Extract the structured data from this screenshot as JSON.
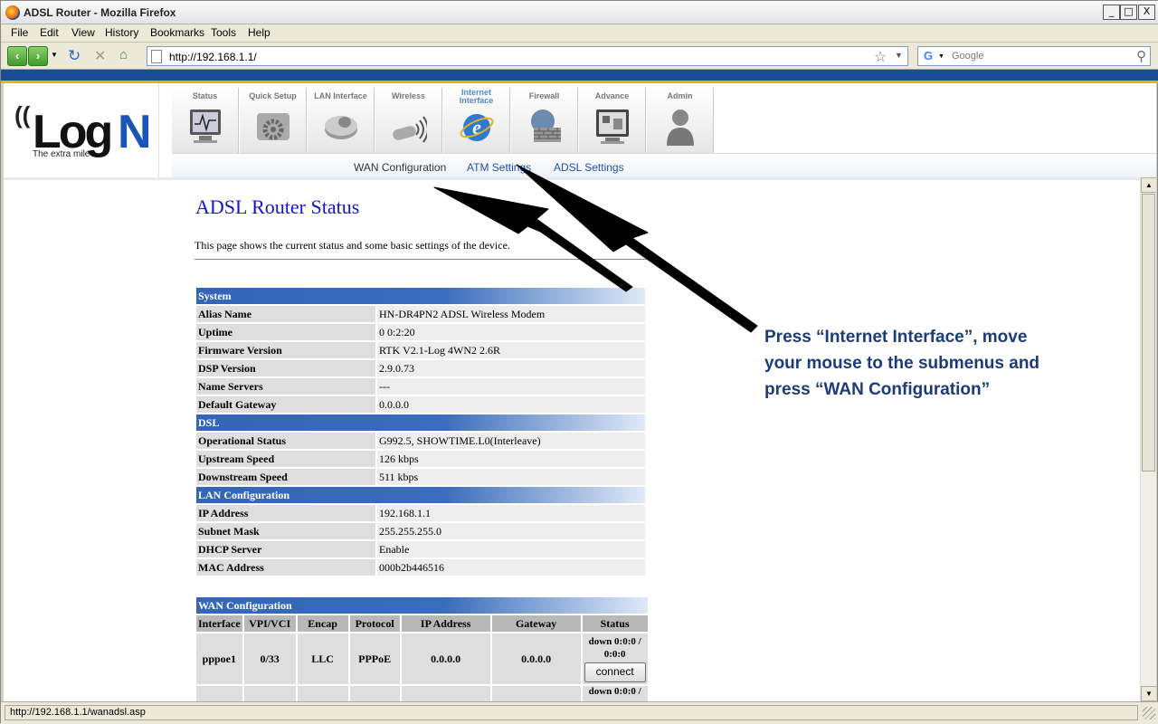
{
  "window": {
    "title": "ADSL Router - Mozilla Firefox",
    "min": "_",
    "max": "□",
    "close": "X"
  },
  "menu": [
    "File",
    "Edit",
    "View",
    "History",
    "Bookmarks",
    "Tools",
    "Help"
  ],
  "toolbar": {
    "url": "http://192.168.1.1/",
    "search_placeholder": "Google"
  },
  "logo": {
    "main": "Log",
    "accent": "N",
    "tagline": "The extra mile"
  },
  "tabs": [
    {
      "label": "Status",
      "icon": "monitor-icon"
    },
    {
      "label": "Quick Setup",
      "icon": "gear-icon"
    },
    {
      "label": "LAN Interface",
      "icon": "hard-drive-icon"
    },
    {
      "label": "Wireless",
      "icon": "wireless-adapter-icon"
    },
    {
      "label": "Internet\nInterface",
      "icon": "internet-explorer-icon"
    },
    {
      "label": "Firewall",
      "icon": "firewall-icon"
    },
    {
      "label": "Advance",
      "icon": "advance-monitor-icon"
    },
    {
      "label": "Admin",
      "icon": "user-icon"
    }
  ],
  "subnav": [
    "WAN Configuration",
    "ATM Settings",
    "ADSL Settings"
  ],
  "page": {
    "title": "ADSL Router Status",
    "description": "This page shows the current status and some basic settings of the device."
  },
  "system": {
    "header": "System",
    "rows": [
      {
        "label": "Alias Name",
        "value": "HN-DR4PN2 ADSL Wireless Modem"
      },
      {
        "label": "Uptime",
        "value": "0 0:2:20"
      },
      {
        "label": "Firmware Version",
        "value": "RTK V2.1-Log 4WN2 2.6R"
      },
      {
        "label": "DSP Version",
        "value": "2.9.0.73"
      },
      {
        "label": "Name Servers",
        "value": "---"
      },
      {
        "label": "Default Gateway",
        "value": "0.0.0.0"
      }
    ]
  },
  "dsl": {
    "header": "DSL",
    "rows": [
      {
        "label": "Operational Status",
        "value": "G992.5, SHOWTIME.L0(Interleave)"
      },
      {
        "label": "Upstream Speed",
        "value": "126 kbps"
      },
      {
        "label": "Downstream Speed",
        "value": "511 kbps"
      }
    ]
  },
  "lan": {
    "header": "LAN Configuration",
    "rows": [
      {
        "label": "IP Address",
        "value": "192.168.1.1"
      },
      {
        "label": "Subnet Mask",
        "value": "255.255.255.0"
      },
      {
        "label": "DHCP Server",
        "value": "Enable"
      },
      {
        "label": "MAC Address",
        "value": "000b2b446516"
      }
    ]
  },
  "wan": {
    "header": "WAN Configuration",
    "columns": [
      "Interface",
      "VPI/VCI",
      "Encap",
      "Protocol",
      "IP Address",
      "Gateway",
      "Status"
    ],
    "rows": [
      {
        "interface": "pppoe1",
        "vpivci": "0/33",
        "encap": "LLC",
        "protocol": "PPPoE",
        "ip": "0.0.0.0",
        "gateway": "0.0.0.0",
        "status": "down 0:0:0 / 0:0:0",
        "button": "connect"
      },
      {
        "status": "down 0:0:0 /"
      }
    ]
  },
  "annotation": {
    "line1": "Press “Internet Interface”,  move",
    "line2": "your mouse to the submenus and",
    "line3": "press “WAN Configuration”"
  },
  "statusbar": {
    "text": "http://192.168.1.1/wanadsl.asp"
  },
  "colors": {
    "section_header": "#3366b8",
    "title_blue": "#1414c8",
    "note_text": "#1c3c78",
    "brand_blue": "#1a56b6"
  }
}
